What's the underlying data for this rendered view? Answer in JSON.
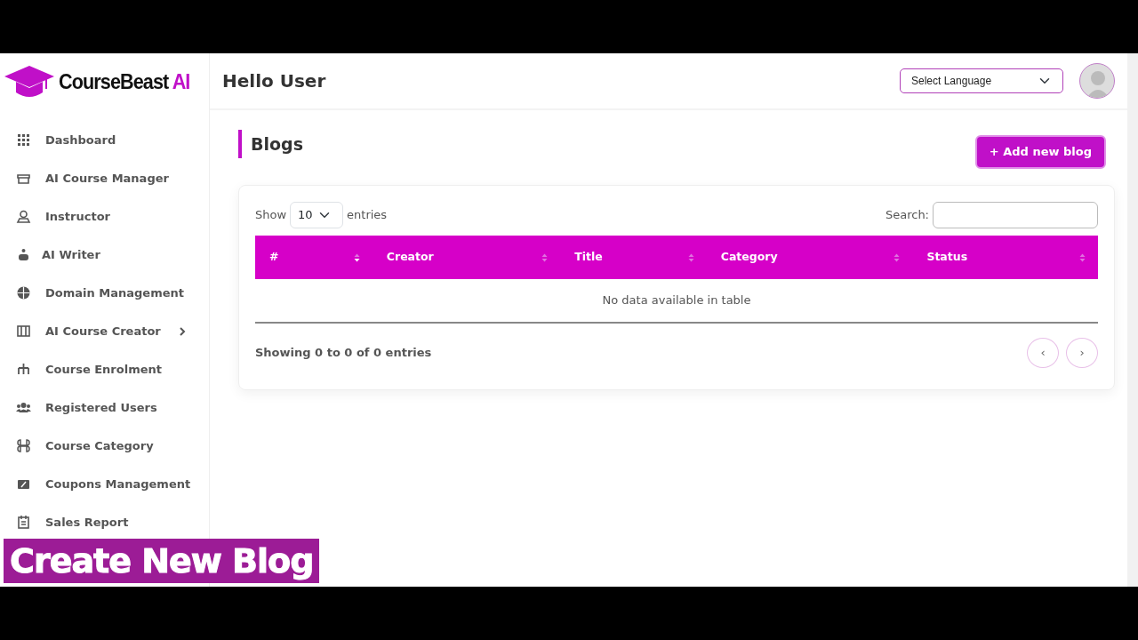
{
  "brand": {
    "name": "CourseBeast",
    "suffix": "AI"
  },
  "header": {
    "greeting": "Hello User",
    "language_select": "Select Language"
  },
  "sidebar": {
    "items": [
      {
        "label": "Dashboard",
        "expandable": false
      },
      {
        "label": "AI Course Manager",
        "expandable": false
      },
      {
        "label": "Instructor",
        "expandable": false
      },
      {
        "label": "AI Writer",
        "expandable": false
      },
      {
        "label": "Domain Management",
        "expandable": false
      },
      {
        "label": "AI Course Creator",
        "expandable": true
      },
      {
        "label": "Course Enrolment",
        "expandable": false
      },
      {
        "label": "Registered Users",
        "expandable": false
      },
      {
        "label": "Course Category",
        "expandable": false
      },
      {
        "label": "Coupons Management",
        "expandable": false
      },
      {
        "label": "Sales Report",
        "expandable": false
      }
    ]
  },
  "page": {
    "title": "Blogs",
    "add_button": "+ Add new blog"
  },
  "table": {
    "show_label": "Show",
    "page_size": "10",
    "entries_label": "entries",
    "search_label": "Search:",
    "columns": [
      {
        "label": "#",
        "sorted": true
      },
      {
        "label": "Creator",
        "sorted": false
      },
      {
        "label": "Title",
        "sorted": false
      },
      {
        "label": "Category",
        "sorted": false
      },
      {
        "label": "Status",
        "sorted": false
      }
    ],
    "empty_message": "No data available in table",
    "info": "Showing 0 to 0 of 0 entries",
    "pagination": {
      "prev": "‹",
      "next": "›"
    }
  },
  "caption": "Create New Blog"
}
